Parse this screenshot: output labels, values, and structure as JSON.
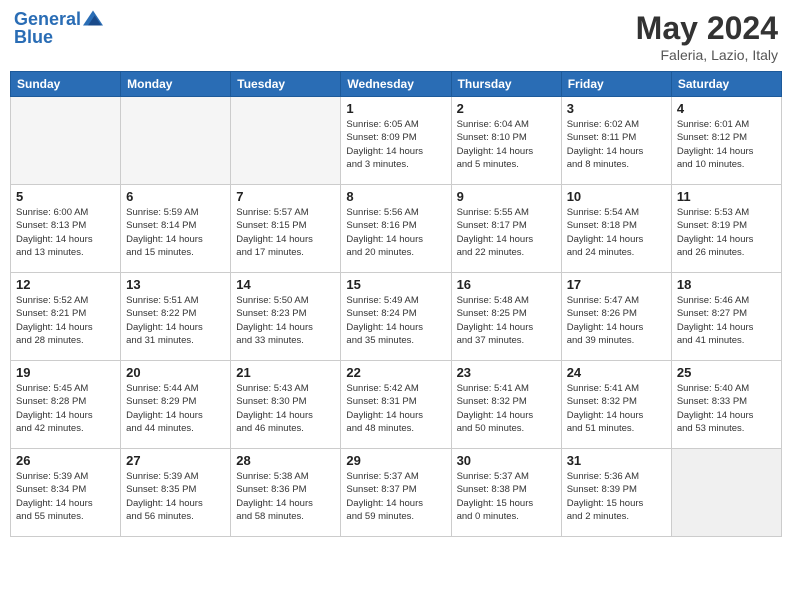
{
  "header": {
    "logo_line1": "General",
    "logo_line2": "Blue",
    "main_title": "May 2024",
    "sub_title": "Faleria, Lazio, Italy"
  },
  "weekdays": [
    "Sunday",
    "Monday",
    "Tuesday",
    "Wednesday",
    "Thursday",
    "Friday",
    "Saturday"
  ],
  "weeks": [
    [
      {
        "day": "",
        "empty": true
      },
      {
        "day": "",
        "empty": true
      },
      {
        "day": "",
        "empty": true
      },
      {
        "day": "1",
        "sunrise": "6:05 AM",
        "sunset": "8:09 PM",
        "daylight": "14 hours and 3 minutes."
      },
      {
        "day": "2",
        "sunrise": "6:04 AM",
        "sunset": "8:10 PM",
        "daylight": "14 hours and 5 minutes."
      },
      {
        "day": "3",
        "sunrise": "6:02 AM",
        "sunset": "8:11 PM",
        "daylight": "14 hours and 8 minutes."
      },
      {
        "day": "4",
        "sunrise": "6:01 AM",
        "sunset": "8:12 PM",
        "daylight": "14 hours and 10 minutes."
      }
    ],
    [
      {
        "day": "5",
        "sunrise": "6:00 AM",
        "sunset": "8:13 PM",
        "daylight": "14 hours and 13 minutes."
      },
      {
        "day": "6",
        "sunrise": "5:59 AM",
        "sunset": "8:14 PM",
        "daylight": "14 hours and 15 minutes."
      },
      {
        "day": "7",
        "sunrise": "5:57 AM",
        "sunset": "8:15 PM",
        "daylight": "14 hours and 17 minutes."
      },
      {
        "day": "8",
        "sunrise": "5:56 AM",
        "sunset": "8:16 PM",
        "daylight": "14 hours and 20 minutes."
      },
      {
        "day": "9",
        "sunrise": "5:55 AM",
        "sunset": "8:17 PM",
        "daylight": "14 hours and 22 minutes."
      },
      {
        "day": "10",
        "sunrise": "5:54 AM",
        "sunset": "8:18 PM",
        "daylight": "14 hours and 24 minutes."
      },
      {
        "day": "11",
        "sunrise": "5:53 AM",
        "sunset": "8:19 PM",
        "daylight": "14 hours and 26 minutes."
      }
    ],
    [
      {
        "day": "12",
        "sunrise": "5:52 AM",
        "sunset": "8:21 PM",
        "daylight": "14 hours and 28 minutes."
      },
      {
        "day": "13",
        "sunrise": "5:51 AM",
        "sunset": "8:22 PM",
        "daylight": "14 hours and 31 minutes."
      },
      {
        "day": "14",
        "sunrise": "5:50 AM",
        "sunset": "8:23 PM",
        "daylight": "14 hours and 33 minutes."
      },
      {
        "day": "15",
        "sunrise": "5:49 AM",
        "sunset": "8:24 PM",
        "daylight": "14 hours and 35 minutes."
      },
      {
        "day": "16",
        "sunrise": "5:48 AM",
        "sunset": "8:25 PM",
        "daylight": "14 hours and 37 minutes."
      },
      {
        "day": "17",
        "sunrise": "5:47 AM",
        "sunset": "8:26 PM",
        "daylight": "14 hours and 39 minutes."
      },
      {
        "day": "18",
        "sunrise": "5:46 AM",
        "sunset": "8:27 PM",
        "daylight": "14 hours and 41 minutes."
      }
    ],
    [
      {
        "day": "19",
        "sunrise": "5:45 AM",
        "sunset": "8:28 PM",
        "daylight": "14 hours and 42 minutes."
      },
      {
        "day": "20",
        "sunrise": "5:44 AM",
        "sunset": "8:29 PM",
        "daylight": "14 hours and 44 minutes."
      },
      {
        "day": "21",
        "sunrise": "5:43 AM",
        "sunset": "8:30 PM",
        "daylight": "14 hours and 46 minutes."
      },
      {
        "day": "22",
        "sunrise": "5:42 AM",
        "sunset": "8:31 PM",
        "daylight": "14 hours and 48 minutes."
      },
      {
        "day": "23",
        "sunrise": "5:41 AM",
        "sunset": "8:32 PM",
        "daylight": "14 hours and 50 minutes."
      },
      {
        "day": "24",
        "sunrise": "5:41 AM",
        "sunset": "8:32 PM",
        "daylight": "14 hours and 51 minutes."
      },
      {
        "day": "25",
        "sunrise": "5:40 AM",
        "sunset": "8:33 PM",
        "daylight": "14 hours and 53 minutes."
      }
    ],
    [
      {
        "day": "26",
        "sunrise": "5:39 AM",
        "sunset": "8:34 PM",
        "daylight": "14 hours and 55 minutes."
      },
      {
        "day": "27",
        "sunrise": "5:39 AM",
        "sunset": "8:35 PM",
        "daylight": "14 hours and 56 minutes."
      },
      {
        "day": "28",
        "sunrise": "5:38 AM",
        "sunset": "8:36 PM",
        "daylight": "14 hours and 58 minutes."
      },
      {
        "day": "29",
        "sunrise": "5:37 AM",
        "sunset": "8:37 PM",
        "daylight": "14 hours and 59 minutes."
      },
      {
        "day": "30",
        "sunrise": "5:37 AM",
        "sunset": "8:38 PM",
        "daylight": "15 hours and 0 minutes."
      },
      {
        "day": "31",
        "sunrise": "5:36 AM",
        "sunset": "8:39 PM",
        "daylight": "15 hours and 2 minutes."
      },
      {
        "day": "",
        "empty": true
      }
    ]
  ],
  "labels": {
    "sunrise": "Sunrise:",
    "sunset": "Sunset:",
    "daylight": "Daylight hours"
  }
}
